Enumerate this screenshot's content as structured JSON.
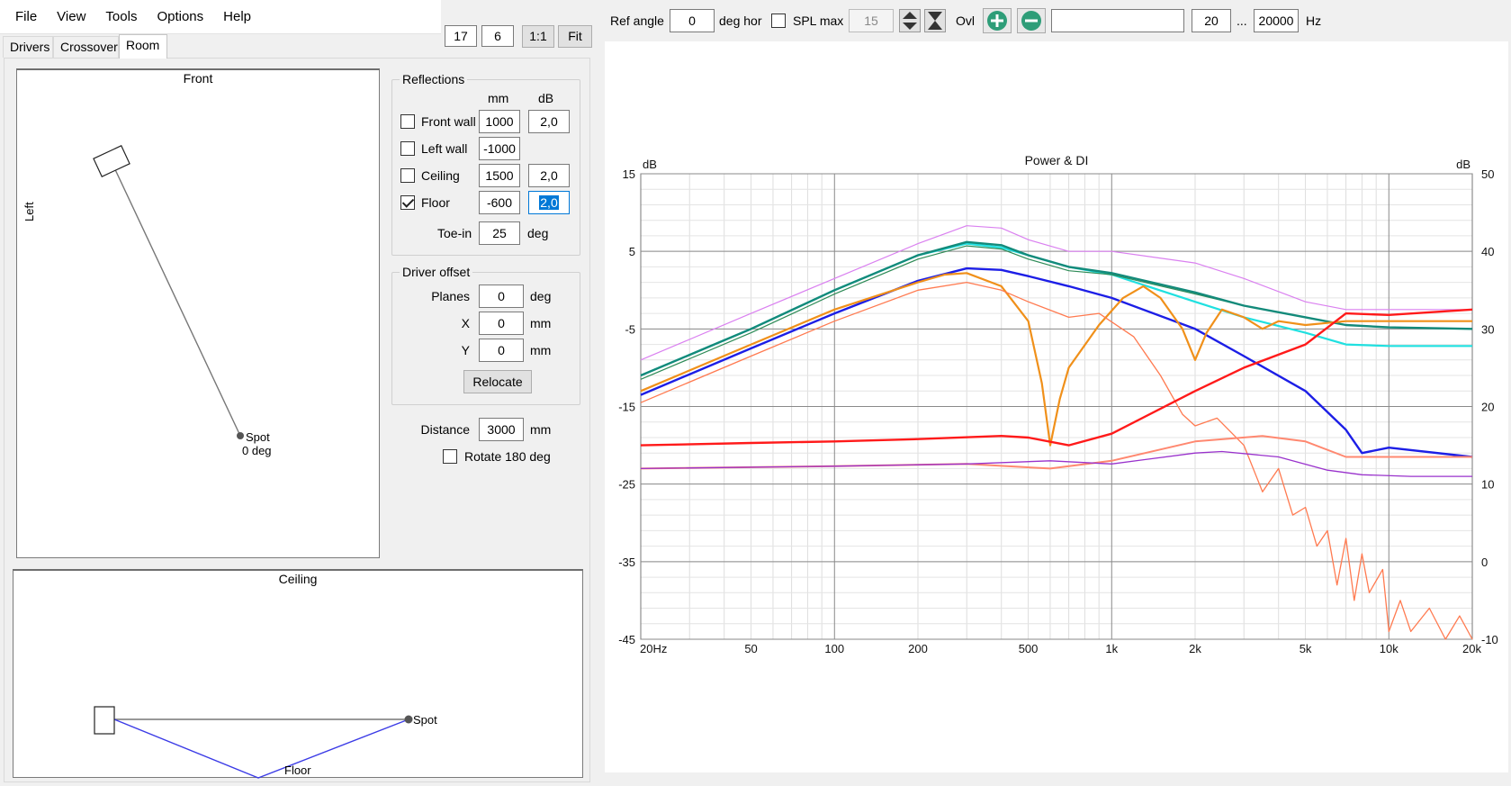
{
  "menu": [
    "File",
    "View",
    "Tools",
    "Options",
    "Help"
  ],
  "tabs": [
    {
      "label": "Drivers",
      "active": false
    },
    {
      "label": "Crossover",
      "active": false
    },
    {
      "label": "Room",
      "active": true
    }
  ],
  "view_controls": {
    "field1": "17",
    "field2": "6",
    "one_to_one": "1:1",
    "fit": "Fit"
  },
  "front_view": {
    "title": "Front",
    "side_label": "Left",
    "spot_label": "Spot",
    "spot_angle": "0 deg"
  },
  "ceiling_view": {
    "title": "Ceiling",
    "spot_label": "Spot",
    "floor_label": "Floor"
  },
  "reflections": {
    "title": "Reflections",
    "col_mm": "mm",
    "col_db": "dB",
    "rows": [
      {
        "label": "Front wall",
        "checked": false,
        "mm": "1000",
        "db": "2,0"
      },
      {
        "label": "Left wall",
        "checked": false,
        "mm": "-1000",
        "db": null
      },
      {
        "label": "Ceiling",
        "checked": false,
        "mm": "1500",
        "db": "2,0"
      },
      {
        "label": "Floor",
        "checked": true,
        "mm": "-600",
        "db": "2,0"
      }
    ],
    "toe_in_label": "Toe-in",
    "toe_in_value": "25",
    "toe_in_unit": "deg"
  },
  "driver_offset": {
    "title": "Driver offset",
    "planes_label": "Planes",
    "planes_value": "0",
    "planes_unit": "deg",
    "x_label": "X",
    "x_value": "0",
    "x_unit": "mm",
    "y_label": "Y",
    "y_value": "0",
    "y_unit": "mm",
    "relocate": "Relocate"
  },
  "distance": {
    "label": "Distance",
    "value": "3000",
    "unit": "mm"
  },
  "rotate": {
    "label": "Rotate 180 deg",
    "checked": false
  },
  "toolbar": {
    "ref_angle_label": "Ref angle",
    "ref_angle_value": "0",
    "ref_angle_unit": "deg hor",
    "spl_max_label": "SPL max",
    "spl_max_value": "15",
    "ovl_label": "Ovl",
    "ovl_text": "",
    "freq_min": "20",
    "freq_sep": "...",
    "freq_max": "20000",
    "freq_unit": "Hz"
  },
  "colors": {
    "accent_green": "#2e9d78",
    "selection": "#0078d7"
  },
  "chart_data": {
    "type": "line",
    "title": "Power & DI",
    "ylabel_left": "dB",
    "ylabel_right": "dB",
    "x_scale": "log",
    "xlim": [
      20,
      20000
    ],
    "ylim_left": [
      -45,
      15
    ],
    "ylim_right": [
      -10,
      50
    ],
    "x_ticks": [
      {
        "v": 20,
        "label": "20Hz"
      },
      {
        "v": 50,
        "label": "50"
      },
      {
        "v": 100,
        "label": "100"
      },
      {
        "v": 200,
        "label": "200"
      },
      {
        "v": 500,
        "label": "500"
      },
      {
        "v": 1000,
        "label": "1k"
      },
      {
        "v": 2000,
        "label": "2k"
      },
      {
        "v": 5000,
        "label": "5k"
      },
      {
        "v": 10000,
        "label": "10k"
      },
      {
        "v": 20000,
        "label": "20k"
      }
    ],
    "y_ticks_left": [
      15,
      5,
      -5,
      -15,
      -25,
      -35,
      -45
    ],
    "y_ticks_right": [
      50,
      40,
      30,
      20,
      10,
      0,
      -10
    ],
    "grid": true,
    "series": [
      {
        "color": "#da80f0",
        "width": 1.2,
        "axis": "left",
        "points": [
          [
            20,
            -9
          ],
          [
            50,
            -3
          ],
          [
            100,
            1.5
          ],
          [
            200,
            6
          ],
          [
            300,
            8.3
          ],
          [
            400,
            8
          ],
          [
            500,
            6.5
          ],
          [
            700,
            5
          ],
          [
            1000,
            5
          ],
          [
            2000,
            3.5
          ],
          [
            3000,
            1.5
          ],
          [
            5000,
            -1.5
          ],
          [
            7000,
            -2.5
          ],
          [
            10000,
            -2.5
          ],
          [
            20000,
            -2.5
          ]
        ]
      },
      {
        "color": "#20e0e0",
        "width": 2.2,
        "axis": "left",
        "points": [
          [
            20,
            -11
          ],
          [
            50,
            -5
          ],
          [
            100,
            0
          ],
          [
            200,
            4.5
          ],
          [
            300,
            6
          ],
          [
            400,
            5.5
          ],
          [
            500,
            4.5
          ],
          [
            700,
            3
          ],
          [
            1000,
            2
          ],
          [
            2000,
            -1.5
          ],
          [
            3000,
            -3.5
          ],
          [
            5000,
            -5.5
          ],
          [
            7000,
            -7
          ],
          [
            10000,
            -7.2
          ],
          [
            20000,
            -7.2
          ]
        ]
      },
      {
        "color": "#2e8b57",
        "width": 1.2,
        "axis": "left",
        "points": [
          [
            20,
            -11.5
          ],
          [
            50,
            -5.5
          ],
          [
            100,
            -0.5
          ],
          [
            200,
            4
          ],
          [
            300,
            5.7
          ],
          [
            400,
            5.3
          ],
          [
            500,
            4
          ],
          [
            700,
            2.5
          ],
          [
            1000,
            2
          ],
          [
            2000,
            -0.5
          ],
          [
            3000,
            -2
          ],
          [
            5000,
            -3.5
          ],
          [
            7000,
            -4.5
          ],
          [
            10000,
            -4.8
          ],
          [
            20000,
            -5
          ]
        ]
      },
      {
        "color": "#138a7a",
        "width": 2.4,
        "axis": "left",
        "points": [
          [
            20,
            -11
          ],
          [
            50,
            -5
          ],
          [
            100,
            0
          ],
          [
            200,
            4.5
          ],
          [
            300,
            6.2
          ],
          [
            400,
            5.8
          ],
          [
            500,
            4.5
          ],
          [
            700,
            3
          ],
          [
            1000,
            2.2
          ],
          [
            2000,
            -0.3
          ],
          [
            3000,
            -2
          ],
          [
            5000,
            -3.5
          ],
          [
            7000,
            -4.5
          ],
          [
            10000,
            -4.8
          ],
          [
            20000,
            -5
          ]
        ]
      },
      {
        "color": "#1c1ee6",
        "width": 2.4,
        "axis": "left",
        "points": [
          [
            20,
            -13.5
          ],
          [
            50,
            -7.5
          ],
          [
            100,
            -3
          ],
          [
            200,
            1.2
          ],
          [
            300,
            2.8
          ],
          [
            400,
            2.6
          ],
          [
            500,
            1.8
          ],
          [
            700,
            0.5
          ],
          [
            1000,
            -1
          ],
          [
            2000,
            -5
          ],
          [
            3000,
            -8.5
          ],
          [
            5000,
            -13
          ],
          [
            7000,
            -18
          ],
          [
            8000,
            -21
          ],
          [
            10000,
            -20.3
          ],
          [
            20000,
            -21.5
          ]
        ]
      },
      {
        "color": "#f0901a",
        "width": 2.2,
        "axis": "left",
        "points": [
          [
            20,
            -13
          ],
          [
            50,
            -7
          ],
          [
            100,
            -2.5
          ],
          [
            200,
            1
          ],
          [
            250,
            2
          ],
          [
            300,
            2.2
          ],
          [
            400,
            0.5
          ],
          [
            500,
            -4
          ],
          [
            560,
            -12
          ],
          [
            600,
            -20
          ],
          [
            650,
            -14
          ],
          [
            700,
            -10
          ],
          [
            900,
            -4.5
          ],
          [
            1100,
            -1
          ],
          [
            1300,
            0.5
          ],
          [
            1500,
            -1
          ],
          [
            1800,
            -5
          ],
          [
            2000,
            -9
          ],
          [
            2200,
            -5.5
          ],
          [
            2500,
            -2.5
          ],
          [
            3000,
            -3.5
          ],
          [
            3500,
            -5
          ],
          [
            4000,
            -4
          ],
          [
            5000,
            -4.5
          ],
          [
            7000,
            -4
          ],
          [
            10000,
            -4
          ],
          [
            20000,
            -4
          ]
        ]
      },
      {
        "color": "#ff7a50",
        "width": 1.3,
        "axis": "left",
        "points": [
          [
            20,
            -14.5
          ],
          [
            50,
            -8.5
          ],
          [
            100,
            -4
          ],
          [
            200,
            0
          ],
          [
            300,
            1
          ],
          [
            400,
            0
          ],
          [
            500,
            -1.5
          ],
          [
            700,
            -3.5
          ],
          [
            900,
            -3
          ],
          [
            1200,
            -6
          ],
          [
            1500,
            -11
          ],
          [
            1800,
            -16
          ],
          [
            2000,
            -17.5
          ],
          [
            2400,
            -16.5
          ],
          [
            3000,
            -20
          ],
          [
            3500,
            -26
          ],
          [
            4000,
            -23
          ],
          [
            4500,
            -29
          ],
          [
            5000,
            -28
          ],
          [
            5500,
            -33
          ],
          [
            6000,
            -31
          ],
          [
            6500,
            -38
          ],
          [
            7000,
            -32
          ],
          [
            7500,
            -40
          ],
          [
            8000,
            -34
          ],
          [
            8500,
            -39
          ],
          [
            9500,
            -36
          ],
          [
            10000,
            -44
          ],
          [
            11000,
            -40
          ],
          [
            12000,
            -44
          ],
          [
            14000,
            -41
          ],
          [
            16000,
            -45
          ],
          [
            18000,
            -42
          ],
          [
            20000,
            -46
          ]
        ]
      },
      {
        "color": "#ff1a1a",
        "width": 2.4,
        "axis": "right",
        "points": [
          [
            20,
            15
          ],
          [
            50,
            15.3
          ],
          [
            100,
            15.5
          ],
          [
            200,
            15.8
          ],
          [
            400,
            16.2
          ],
          [
            500,
            16
          ],
          [
            700,
            15
          ],
          [
            1000,
            16.5
          ],
          [
            2000,
            22
          ],
          [
            3000,
            25
          ],
          [
            5000,
            28
          ],
          [
            7000,
            32
          ],
          [
            10000,
            31.8
          ],
          [
            20000,
            32.5
          ]
        ]
      },
      {
        "color": "#ff8870",
        "width": 2.0,
        "axis": "right",
        "points": [
          [
            20,
            12
          ],
          [
            100,
            12.3
          ],
          [
            300,
            12.6
          ],
          [
            600,
            12
          ],
          [
            1000,
            13
          ],
          [
            2000,
            15.5
          ],
          [
            3500,
            16.2
          ],
          [
            5000,
            15.5
          ],
          [
            7000,
            13.5
          ],
          [
            10000,
            13.5
          ],
          [
            20000,
            13.5
          ]
        ]
      },
      {
        "color": "#9932cc",
        "width": 1.3,
        "axis": "right",
        "points": [
          [
            20,
            12
          ],
          [
            100,
            12.3
          ],
          [
            300,
            12.6
          ],
          [
            600,
            13
          ],
          [
            1000,
            12.6
          ],
          [
            2000,
            14
          ],
          [
            2500,
            14.2
          ],
          [
            4000,
            13.5
          ],
          [
            6000,
            11.8
          ],
          [
            8000,
            11.2
          ],
          [
            12000,
            11
          ],
          [
            20000,
            11
          ]
        ]
      }
    ]
  }
}
